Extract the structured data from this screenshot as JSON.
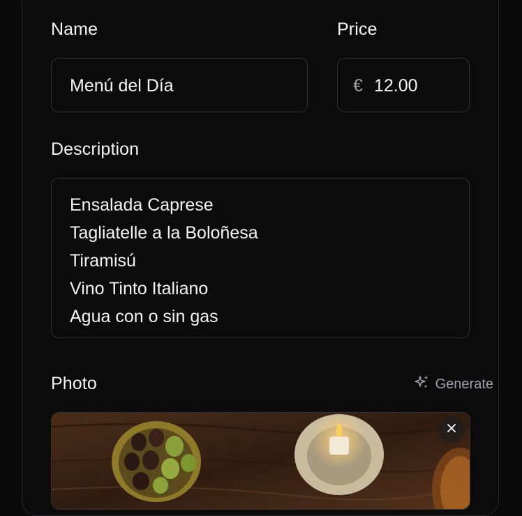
{
  "form": {
    "name_label": "Name",
    "name_value": "Menú del Día",
    "price_label": "Price",
    "price_currency": "€",
    "price_value": "12.00",
    "description_label": "Description",
    "description_lines": [
      "Ensalada Caprese",
      "Tagliatelle a la Boloñesa",
      "Tiramisú",
      "Vino Tinto Italiano",
      "Agua con o sin gas"
    ],
    "photo_label": "Photo",
    "generate_label": "Generate",
    "generate_icon": "sparkles-icon",
    "remove_icon": "close-icon"
  },
  "colors": {
    "background": "#0a0a0a",
    "border": "#333336",
    "text": "#f4f4f5",
    "muted": "#a1a1aa"
  }
}
